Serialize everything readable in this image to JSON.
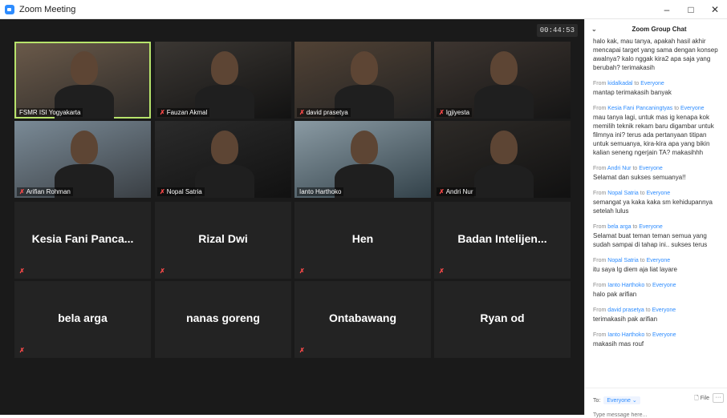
{
  "window": {
    "title": "Zoom Meeting",
    "minimize": "–",
    "maximize": "□",
    "close": "✕"
  },
  "meeting": {
    "timer": "00:44:53"
  },
  "tiles": [
    {
      "name": "FSMR ISI Yogyakarta",
      "video": true
    },
    {
      "name": "Fauzan Akmal",
      "video": true
    },
    {
      "name": "david prasetya",
      "video": true
    },
    {
      "name": "Igjiyesta",
      "video": true
    },
    {
      "name": "Arifian Rohman",
      "video": true
    },
    {
      "name": "Nopal Satria",
      "video": true
    },
    {
      "name": "Ianto Harthoko",
      "video": true
    },
    {
      "name": "Andri Nur",
      "video": true
    },
    {
      "name": "Kesia Fani Panca...",
      "video": false
    },
    {
      "name": "Rizal Dwi",
      "video": false
    },
    {
      "name": "Hen",
      "video": false
    },
    {
      "name": "Badan Intelijen...",
      "video": false
    },
    {
      "name": "bela arga",
      "video": false
    },
    {
      "name": "nanas goreng",
      "video": false
    },
    {
      "name": "Ontabawang",
      "video": false
    },
    {
      "name": "Ryan od",
      "video": false
    }
  ],
  "chat": {
    "title": "Zoom Group Chat",
    "chevron": "⌄",
    "first_body": "halo kak, mau tanya, apakah hasil akhir mencapai target yang sama dengan konsep awalnya? kalo nggak kira2 apa saja yang berubah? terimakasih",
    "messages": [
      {
        "from": "kidalkadal",
        "to": "Everyone",
        "body": "mantap terimakasih banyak"
      },
      {
        "from": "Kesia Fani Pancaningtyas",
        "to": "Everyone",
        "body": "mau tanya lagi, untuk mas ig kenapa kok memilih teknik rekam baru digambar untuk filmnya ini? terus ada pertanyaan titipan untuk semuanya, kira-kira apa yang bikin kalian seneng ngerjain TA? makasihhh"
      },
      {
        "from": "Andri Nur",
        "to": "Everyone",
        "body": "Selamat dan sukses semuanya!!"
      },
      {
        "from": "Nopal Satria",
        "to": "Everyone",
        "body": "semangat ya kaka kaka sm kehidupannya setelah lulus"
      },
      {
        "from": "bela arga",
        "to": "Everyone",
        "body": "Selamat buat teman teman semua yang sudah sampai di tahap ini.. sukses terus"
      },
      {
        "from": "Nopal Satria",
        "to": "Everyone",
        "body": "itu saya lg diem aja liat layare"
      },
      {
        "from": "Ianto Harthoko",
        "to": "Everyone",
        "body": "halo pak arifian"
      },
      {
        "from": "david prasetya",
        "to": "Everyone",
        "body": "terimakasih pak arifian"
      },
      {
        "from": "Ianto Harthoko",
        "to": "Everyone",
        "body": "makasih mas rouf"
      }
    ],
    "from_prefix": "From",
    "to_word": "to",
    "to_label": "To:",
    "to_value": "Everyone ⌄",
    "file_label": "File",
    "more_label": "···",
    "placeholder": "Type message here..."
  }
}
